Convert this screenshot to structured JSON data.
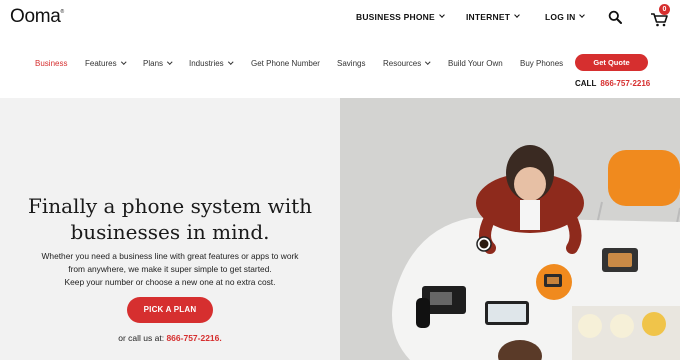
{
  "header": {
    "logo_text": "Ooma",
    "nav": [
      {
        "label": "BUSINESS PHONE"
      },
      {
        "label": "INTERNET"
      },
      {
        "label": "LOG IN"
      }
    ],
    "cart_count": "0"
  },
  "subnav": {
    "items": [
      {
        "label": "Business",
        "active": true
      },
      {
        "label": "Features"
      },
      {
        "label": "Plans"
      },
      {
        "label": "Industries"
      },
      {
        "label": "Get Phone Number"
      },
      {
        "label": "Savings"
      },
      {
        "label": "Resources"
      },
      {
        "label": "Build Your Own"
      },
      {
        "label": "Buy Phones"
      }
    ],
    "quote_label": "Get Quote",
    "call_prefix": "CALL",
    "call_number": "866-757-2216"
  },
  "hero": {
    "headline_line1": "Finally a phone system with",
    "headline_line2": "businesses in mind.",
    "sub_line1": "Whether you need a business line with great features or apps to work",
    "sub_line2": "from anywhere, we make it super simple to get started.",
    "sub_line3": "Keep your number or choose a new one at no extra cost.",
    "cta_label": "PICK A PLAN",
    "or_call_prefix": "or call us at:",
    "or_call_number": "866-757-2216."
  },
  "colors": {
    "accent": "#d62f2f",
    "hero_bg": "#f2f2f2"
  }
}
